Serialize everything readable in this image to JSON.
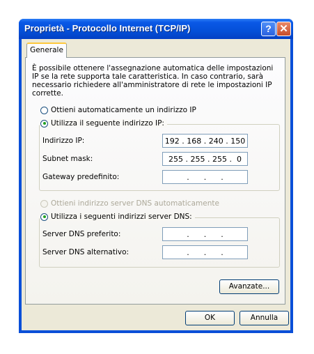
{
  "window": {
    "title": "Proprietà - Protocollo Internet (TCP/IP)",
    "help_glyph": "?",
    "close_glyph": "✕"
  },
  "tabs": [
    {
      "label": "Generale"
    }
  ],
  "description": "È possibile ottenere l'assegnazione automatica delle impostazioni IP se la rete supporta tale caratteristica. In caso contrario, sarà necessario richiedere all'amministratore di rete le impostazioni IP corrette.",
  "ip_mode": {
    "auto_label": "Ottieni automaticamente un indirizzo IP",
    "manual_label": "Utilizza il seguente indirizzo IP:",
    "selected": "manual"
  },
  "ip_fields": {
    "ip_label": "Indirizzo IP:",
    "ip_value": "192 . 168 . 240 . 150",
    "subnet_label": "Subnet mask:",
    "subnet_value": "255 . 255 . 255 .  0",
    "gateway_label": "Gateway predefinito:",
    "gateway_value": " .      .      . "
  },
  "dns_mode": {
    "auto_label": "Ottieni indirizzo server DNS automaticamente",
    "manual_label": "Utilizza i seguenti indirizzi server DNS:",
    "selected": "manual",
    "auto_disabled": true
  },
  "dns_fields": {
    "preferred_label": "Server DNS preferito:",
    "preferred_value": " .      .      . ",
    "alternate_label": "Server DNS alternativo:",
    "alternate_value": " .      .      . "
  },
  "buttons": {
    "advanced": "Avanzate...",
    "ok": "OK",
    "cancel": "Annulla"
  },
  "colors": {
    "titlebar": "#0450d8",
    "client": "#ece9d8",
    "tab_highlight": "#ffc83c",
    "radio_check": "#21a121"
  }
}
